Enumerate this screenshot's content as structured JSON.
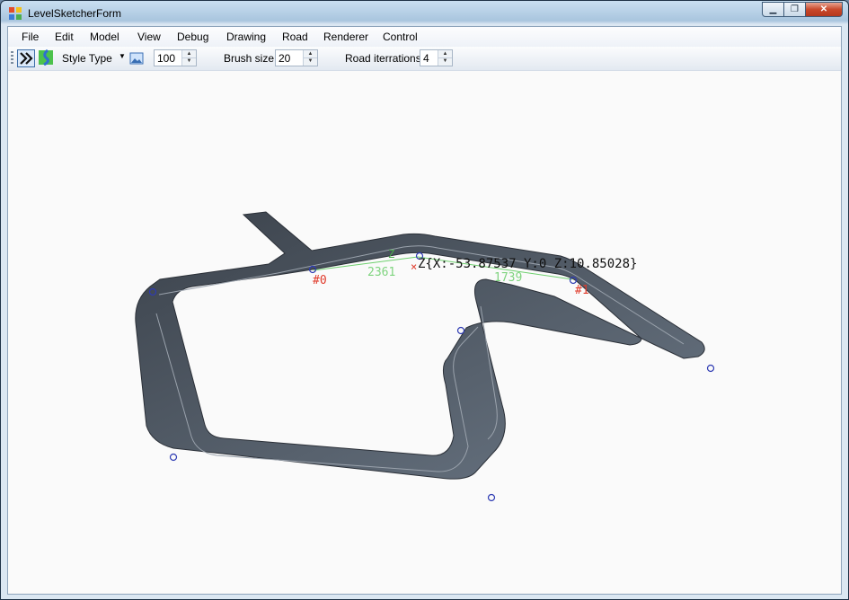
{
  "window": {
    "title": "LevelSketcherForm"
  },
  "menu": [
    "File",
    "Edit",
    "Model",
    "View",
    "Debug",
    "Drawing",
    "Road",
    "Renderer",
    "Control"
  ],
  "toolbar": {
    "style_type_label": "Style Type",
    "zoom_value": "100",
    "brush_label": "Brush size",
    "brush_value": "20",
    "iterations_label": "Road iterrations",
    "iterations_value": "4"
  },
  "viewport": {
    "point_label_0": "#0",
    "point_label_1": "#1",
    "distance_a": "2361",
    "distance_b": "1739",
    "axis_label": "Z",
    "coordinate_readout": "Z{X:-53.87537 Y:0 Z:10.85028}",
    "colors": {
      "road": "#4f5966",
      "road_edge": "#9aa2ac",
      "control_point": "#2e3bb3",
      "guide": "#6fd06f",
      "marker": "#e03a2a"
    }
  }
}
